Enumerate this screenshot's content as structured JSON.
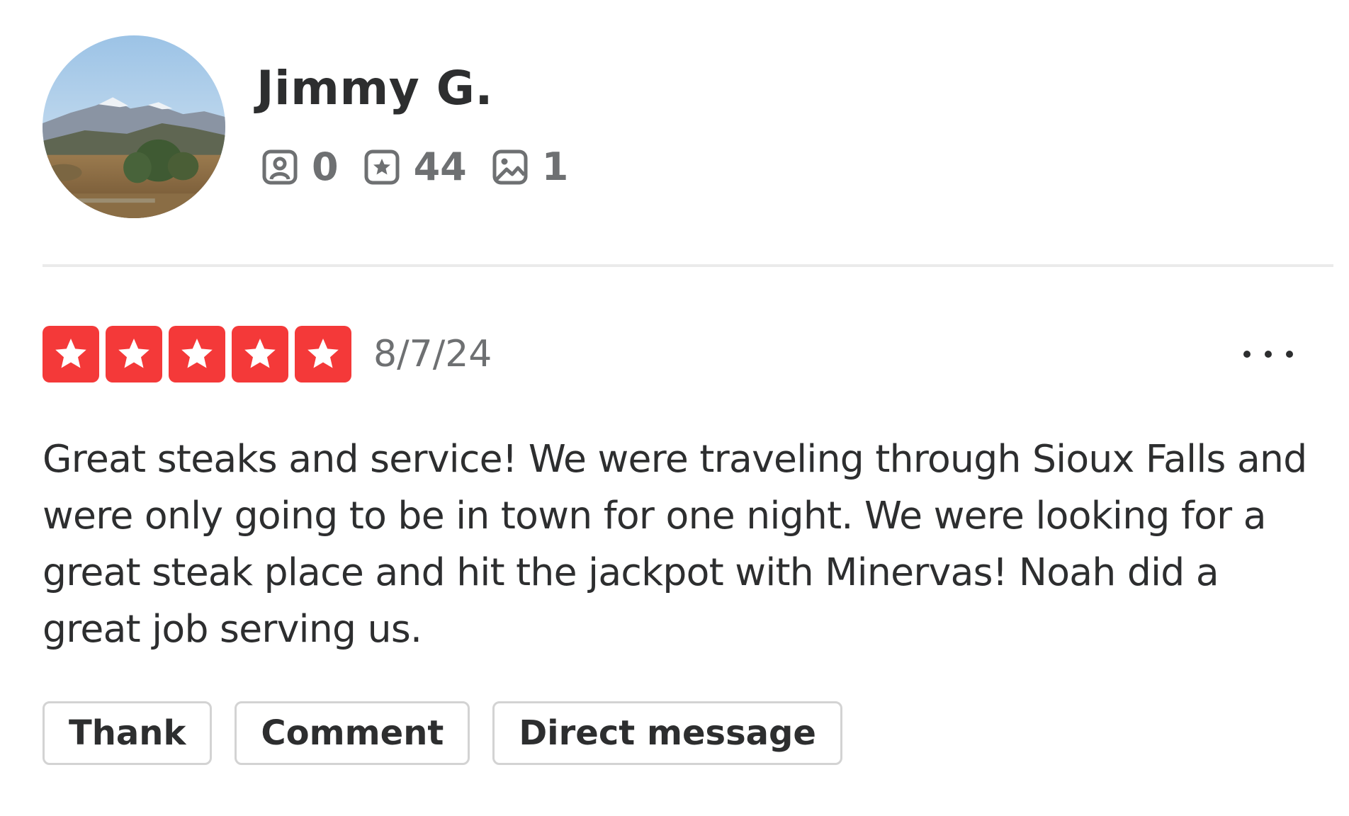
{
  "user": {
    "name": "Jimmy G.",
    "avatar_icon": "mountain-landscape-avatar",
    "stats": [
      {
        "icon": "friends-icon",
        "count": "0"
      },
      {
        "icon": "reviews-star-icon",
        "count": "44"
      },
      {
        "icon": "photos-icon",
        "count": "1"
      }
    ]
  },
  "review": {
    "rating": 5,
    "rating_max": 5,
    "date": "8/7/24",
    "text": "Great steaks and service! We were traveling through Sioux Falls and were only going to be in town for one night. We were looking for a great steak place and hit the jackpot with Minervas! Noah did a great job serving us."
  },
  "actions": {
    "thank_label": "Thank",
    "comment_label": "Comment",
    "direct_message_label": "Direct message",
    "more_icon": "more-options-icon"
  },
  "colors": {
    "star_red": "#f43939",
    "text_dark": "#2d2e2f",
    "text_gray": "#6e7072",
    "border_gray": "#d3d3d3"
  }
}
